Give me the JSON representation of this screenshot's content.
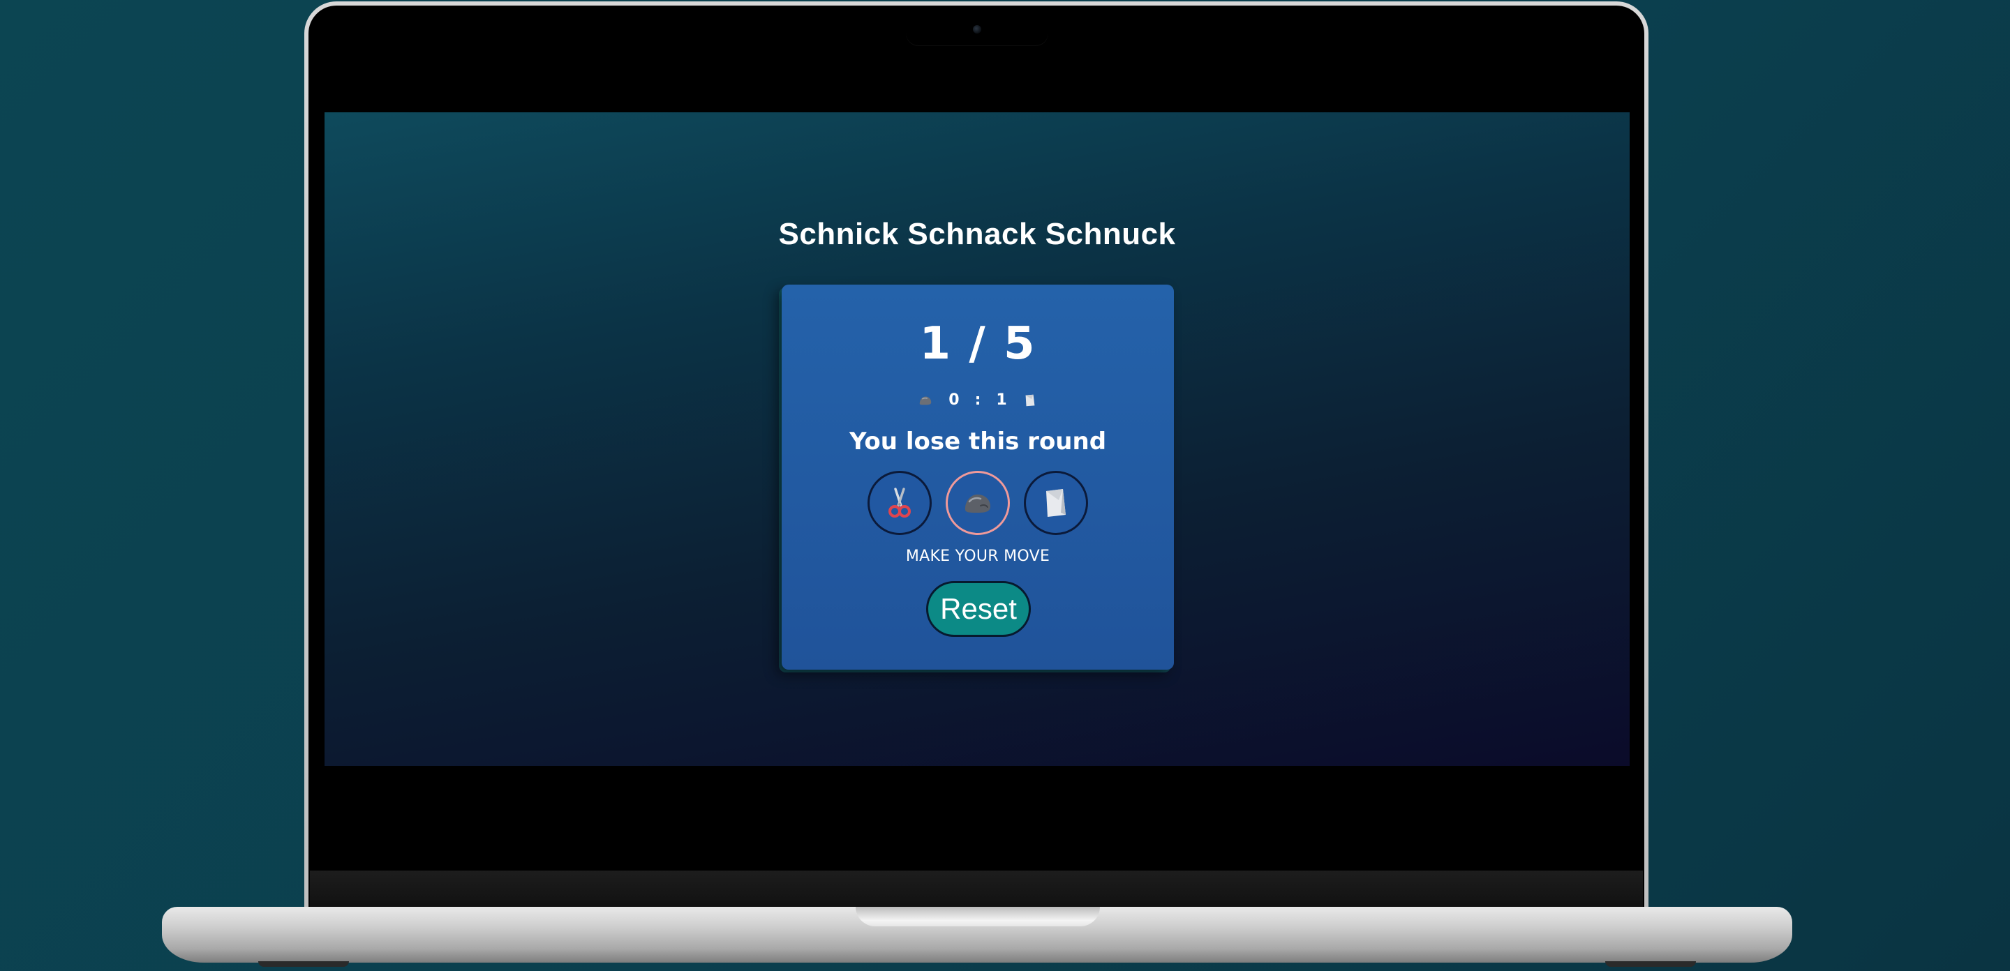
{
  "app": {
    "title": "Schnick Schnack Schnuck"
  },
  "game": {
    "round_label": "1 / 5",
    "current_round": 1,
    "total_rounds": 5,
    "score": {
      "player_icon": "rock-icon",
      "player_score": "0",
      "separator": ":",
      "opponent_score": "1",
      "opponent_icon": "paper-icon"
    },
    "result_message": "You lose this round",
    "choices": [
      {
        "name": "scissors",
        "icon": "scissors-icon",
        "selected": false
      },
      {
        "name": "rock",
        "icon": "rock-icon",
        "selected": true
      },
      {
        "name": "paper",
        "icon": "paper-icon",
        "selected": false
      }
    ],
    "prompt": "MAKE YOUR MOVE",
    "reset_label": "Reset"
  },
  "colors": {
    "card": "#2462aa",
    "reset_button": "#0c8a86",
    "selected_ring": "#f09a9a",
    "text": "#ffffff"
  }
}
